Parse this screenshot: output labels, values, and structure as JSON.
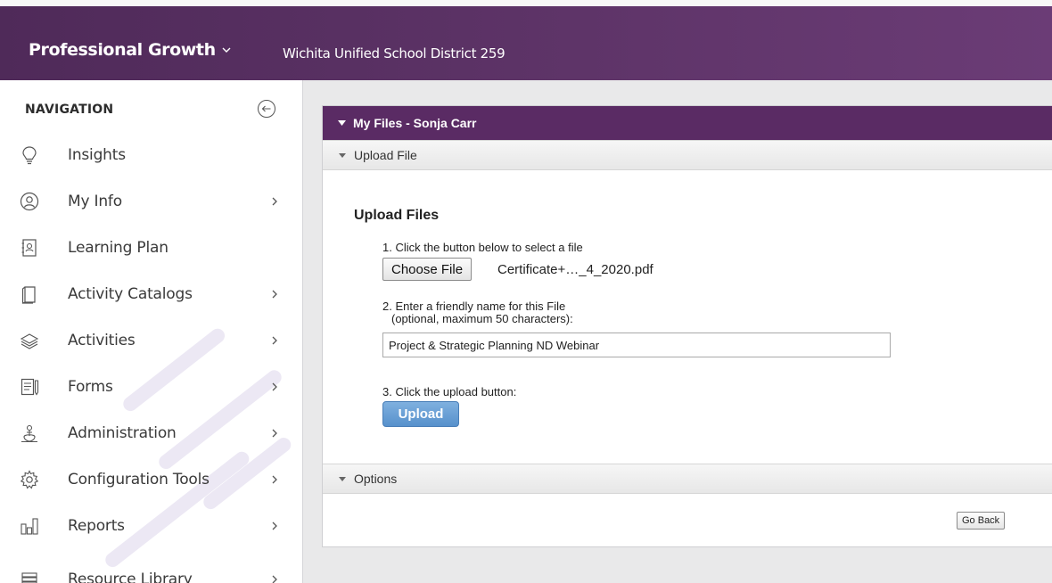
{
  "header": {
    "app_title": "Professional Growth",
    "district": "Wichita Unified School District 259"
  },
  "sidebar": {
    "heading": "NAVIGATION",
    "items": [
      {
        "label": "Insights",
        "icon": "lightbulb-icon",
        "has_arrow": false
      },
      {
        "label": "My Info",
        "icon": "user-circle-icon",
        "has_arrow": true
      },
      {
        "label": "Learning Plan",
        "icon": "contact-book-icon",
        "has_arrow": false
      },
      {
        "label": "Activity Catalogs",
        "icon": "book-icon",
        "has_arrow": true
      },
      {
        "label": "Activities",
        "icon": "layers-icon",
        "has_arrow": true
      },
      {
        "label": "Forms",
        "icon": "form-icon",
        "has_arrow": true
      },
      {
        "label": "Administration",
        "icon": "administrator-icon",
        "has_arrow": true
      },
      {
        "label": "Configuration Tools",
        "icon": "gear-icon",
        "has_arrow": true
      },
      {
        "label": "Reports",
        "icon": "bar-chart-icon",
        "has_arrow": true
      },
      {
        "label": "Resource Library",
        "icon": "stack-icon",
        "has_arrow": true
      }
    ]
  },
  "panel": {
    "title": "My Files - Sonja Carr",
    "upload_section_label": "Upload File",
    "upload_heading": "Upload Files",
    "step1": "1. Click the button below to select a file",
    "choose_file_label": "Choose File",
    "selected_file": "Certificate+…_4_2020.pdf",
    "step2_line1": "2. Enter a friendly name for this File",
    "step2_line2": "(optional, maximum 50 characters):",
    "friendly_name_value": "Project & Strategic Planning ND Webinar",
    "step3": "3. Click the upload button:",
    "upload_label": "Upload",
    "options_section_label": "Options",
    "go_back_label": "Go Back"
  },
  "colors": {
    "header_purple": "#5e3468",
    "panel_header": "#5a2b64",
    "upload_button": "#5791cc"
  }
}
